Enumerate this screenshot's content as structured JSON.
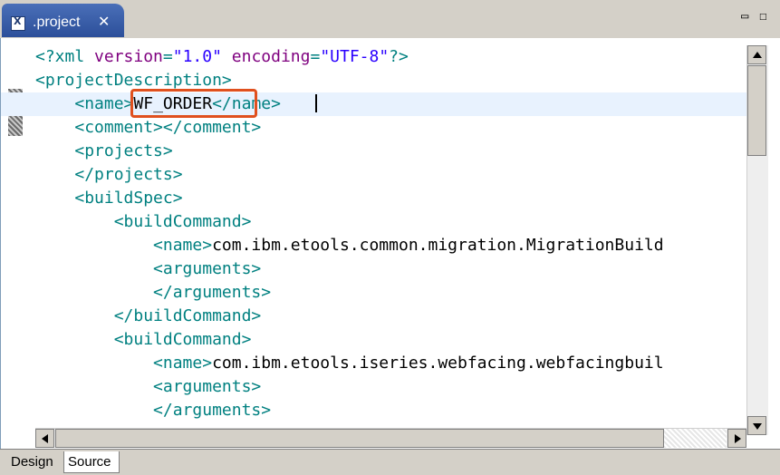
{
  "tab": {
    "title": ".project",
    "close": "✕",
    "icon": "xml-file-icon"
  },
  "window_controls": {
    "minimize": "▭",
    "maximize": "☐"
  },
  "editor": {
    "lines": [
      {
        "parts": [
          [
            "pi",
            "<?xml "
          ],
          [
            "attr",
            "version"
          ],
          [
            "pi",
            "="
          ],
          [
            "val",
            "\"1.0\""
          ],
          [
            "pi",
            " "
          ],
          [
            "attr",
            "encoding"
          ],
          [
            "pi",
            "="
          ],
          [
            "val",
            "\"UTF-8\""
          ],
          [
            "pi",
            "?>"
          ]
        ]
      },
      {
        "parts": [
          [
            "tag",
            "<projectDescription>"
          ]
        ]
      },
      {
        "parts": [
          [
            "txt",
            "    "
          ],
          [
            "tag",
            "<name>"
          ],
          [
            "txt",
            "WF_ORDER"
          ],
          [
            "tag",
            "</name>"
          ]
        ],
        "current": true
      },
      {
        "parts": [
          [
            "txt",
            "    "
          ],
          [
            "tag",
            "<comment></comment>"
          ]
        ]
      },
      {
        "parts": [
          [
            "txt",
            "    "
          ],
          [
            "tag",
            "<projects>"
          ]
        ]
      },
      {
        "parts": [
          [
            "txt",
            "    "
          ],
          [
            "tag",
            "</projects>"
          ]
        ]
      },
      {
        "parts": [
          [
            "txt",
            "    "
          ],
          [
            "tag",
            "<buildSpec>"
          ]
        ]
      },
      {
        "parts": [
          [
            "txt",
            "        "
          ],
          [
            "tag",
            "<buildCommand>"
          ]
        ]
      },
      {
        "parts": [
          [
            "txt",
            "            "
          ],
          [
            "tag",
            "<name>"
          ],
          [
            "txt",
            "com.ibm.etools.common.migration.MigrationBuild"
          ]
        ]
      },
      {
        "parts": [
          [
            "txt",
            "            "
          ],
          [
            "tag",
            "<arguments>"
          ]
        ]
      },
      {
        "parts": [
          [
            "txt",
            "            "
          ],
          [
            "tag",
            "</arguments>"
          ]
        ]
      },
      {
        "parts": [
          [
            "txt",
            "        "
          ],
          [
            "tag",
            "</buildCommand>"
          ]
        ]
      },
      {
        "parts": [
          [
            "txt",
            "        "
          ],
          [
            "tag",
            "<buildCommand>"
          ]
        ]
      },
      {
        "parts": [
          [
            "txt",
            "            "
          ],
          [
            "tag",
            "<name>"
          ],
          [
            "txt",
            "com.ibm.etools.iseries.webfacing.webfacingbuil"
          ]
        ]
      },
      {
        "parts": [
          [
            "txt",
            "            "
          ],
          [
            "tag",
            "<arguments>"
          ]
        ]
      },
      {
        "parts": [
          [
            "txt",
            "            "
          ],
          [
            "tag",
            "</arguments>"
          ]
        ]
      }
    ]
  },
  "bottom_tabs": {
    "design": "Design",
    "source": "Source"
  },
  "colors": {
    "tag": "#008080",
    "attr": "#7f007f",
    "value": "#2a00ff",
    "highlight": "#e0501e",
    "current_line": "#e8f2fe"
  }
}
